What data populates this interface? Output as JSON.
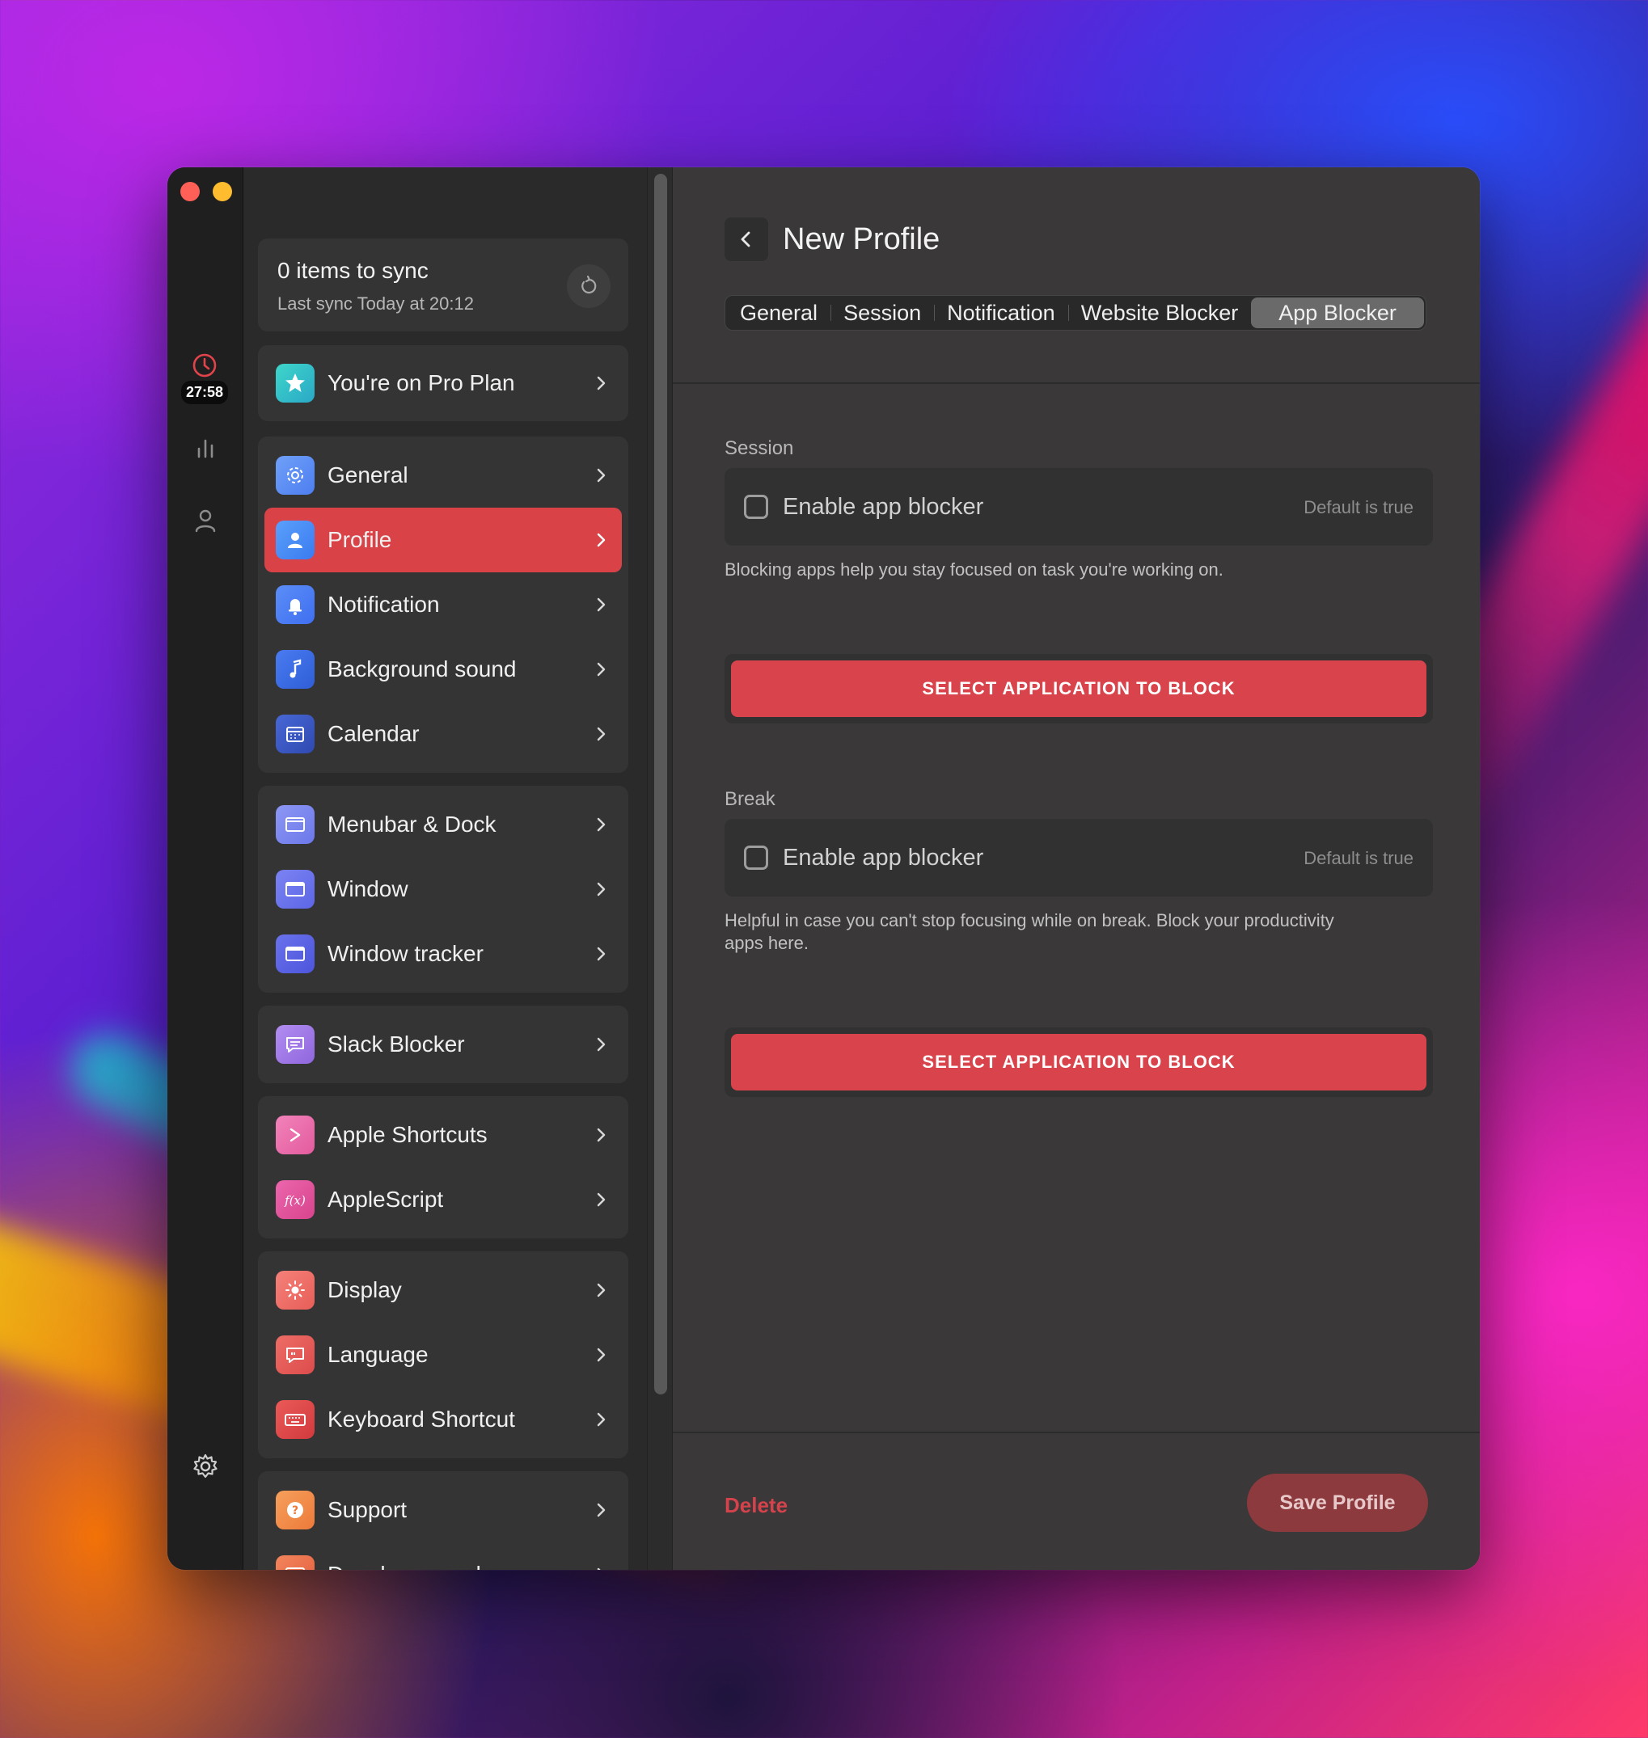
{
  "colors": {
    "accent": "#d94348",
    "window_bg": "#2b2a2b",
    "main_bg": "#3a3839",
    "save_button": "#8c3a3d"
  },
  "rail": {
    "timer": "27:58",
    "icons": [
      "clock-icon",
      "stats-icon",
      "person-icon",
      "gear-icon"
    ]
  },
  "sync": {
    "title": "0 items to sync",
    "subtitle": "Last sync Today at 20:12"
  },
  "sidebar": {
    "pro": {
      "label": "You're on Pro Plan",
      "icon": "star-icon",
      "color": "#2fc5c5"
    },
    "groups": [
      [
        {
          "label": "General",
          "icon": "gear-icon",
          "color": "#5e8df5"
        },
        {
          "label": "Profile",
          "icon": "person-icon",
          "color": "#4a8cf7",
          "active": true
        },
        {
          "label": "Notification",
          "icon": "bell-icon",
          "color": "#4f7ff7"
        },
        {
          "label": "Background sound",
          "icon": "music-note-icon",
          "color": "#3d6de8"
        },
        {
          "label": "Calendar",
          "icon": "calendar-icon",
          "color": "#3d5fc8"
        }
      ],
      [
        {
          "label": "Menubar & Dock",
          "icon": "menubar-icon",
          "color": "#7b86f0"
        },
        {
          "label": "Window",
          "icon": "window-icon",
          "color": "#6c74ef"
        },
        {
          "label": "Window tracker",
          "icon": "window-tracker-icon",
          "color": "#5e66e6"
        }
      ],
      [
        {
          "label": "Slack Blocker",
          "icon": "chat-icon",
          "color": "#a07ae8"
        }
      ],
      [
        {
          "label": "Apple Shortcuts",
          "icon": "shortcuts-icon",
          "color": "#ec6dab"
        },
        {
          "label": "AppleScript",
          "icon": "function-icon",
          "color": "#e5559e"
        }
      ],
      [
        {
          "label": "Display",
          "icon": "sun-icon",
          "color": "#ee6a62"
        },
        {
          "label": "Language",
          "icon": "speech-bubble-icon",
          "color": "#e75a57"
        },
        {
          "label": "Keyboard Shortcut",
          "icon": "keyboard-icon",
          "color": "#e04848"
        }
      ],
      [
        {
          "label": "Support",
          "icon": "question-icon",
          "color": "#f2874a"
        },
        {
          "label": "Developer mode",
          "icon": "developer-icon",
          "color": "#ef6d45"
        }
      ]
    ]
  },
  "header": {
    "title": "New Profile",
    "tabs": [
      {
        "label": "General"
      },
      {
        "label": "Session"
      },
      {
        "label": "Notification"
      },
      {
        "label": "Website Blocker"
      },
      {
        "label": "App Blocker",
        "active": true
      }
    ]
  },
  "session": {
    "label": "Session",
    "option_label": "Enable app blocker",
    "option_default": "Default is true",
    "help": "Blocking apps help you stay focused on task you're working on.",
    "button": "SELECT APPLICATION TO BLOCK"
  },
  "break": {
    "label": "Break",
    "option_label": "Enable app blocker",
    "option_default": "Default is true",
    "help": "Helpful in case you can't stop focusing while on break. Block your productivity apps here.",
    "button": "SELECT APPLICATION TO BLOCK"
  },
  "footer": {
    "delete": "Delete",
    "save": "Save Profile"
  }
}
